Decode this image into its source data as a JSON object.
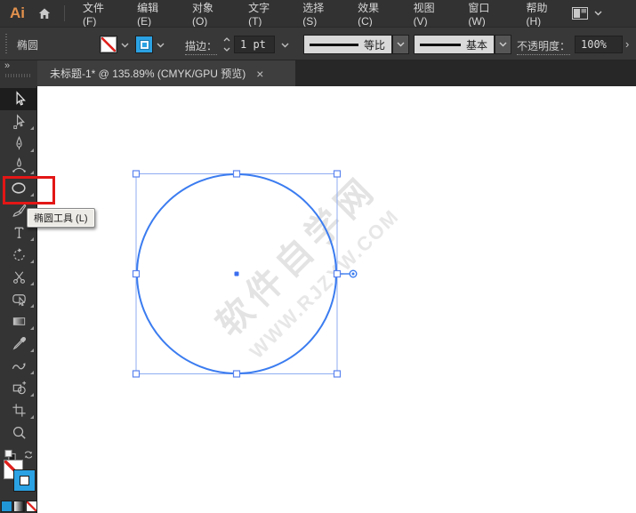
{
  "colors": {
    "shape_stroke_blue": "#3b7cf0",
    "selection_box_blue": "#8fadf2",
    "handle_border_blue": "#5b84ee",
    "stroke_swatch_blue": "#2ba2e3",
    "annotation_red": "#e31616",
    "logo_orange": "#e2914d",
    "canvas_white": "#ffffff"
  },
  "menu_bar": {
    "logo": "Ai",
    "items": [
      {
        "label": "文件(F)"
      },
      {
        "label": "编辑(E)"
      },
      {
        "label": "对象(O)"
      },
      {
        "label": "文字(T)"
      },
      {
        "label": "选择(S)"
      },
      {
        "label": "效果(C)"
      },
      {
        "label": "视图(V)"
      },
      {
        "label": "窗口(W)"
      },
      {
        "label": "帮助(H)"
      }
    ]
  },
  "control_bar": {
    "context_label": "椭圆",
    "stroke_label": "描边：",
    "stroke_weight_value": "1 pt",
    "width_profile_value": "等比",
    "brush_value": "基本",
    "opacity_label": "不透明度：",
    "opacity_value": "100%",
    "more_glyph": "›"
  },
  "tab_bar": {
    "document_title": "未标题-1* @ 135.89% (CMYK/GPU 预览)",
    "close_glyph": "×"
  },
  "toolbar": {
    "expand_glyph": "»",
    "type_tool_glyph": "T",
    "tools": [
      {
        "name": "selection-tool",
        "state": "active"
      },
      {
        "name": "direct-selection-tool"
      },
      {
        "name": "pen-tool"
      },
      {
        "name": "curvature-tool"
      },
      {
        "name": "ellipse-tool",
        "state": "highlighted"
      },
      {
        "name": "paintbrush-tool"
      },
      {
        "name": "type-tool"
      },
      {
        "name": "rotate-tool"
      },
      {
        "name": "scissors-tool"
      },
      {
        "name": "shaper-tool"
      },
      {
        "name": "gradient-tool"
      },
      {
        "name": "eyedropper-tool"
      },
      {
        "name": "width-tool"
      },
      {
        "name": "shape-builder-tool"
      },
      {
        "name": "artboard-tool"
      },
      {
        "name": "zoom-tool"
      }
    ]
  },
  "canvas": {
    "tooltip_text": "椭圆工具 (L)",
    "watermark_line1": "软件自学网",
    "watermark_line2": "WWW.RJZXW.COM",
    "shape": {
      "type": "ellipse",
      "stroke_pt": "1 pt",
      "selected": true
    }
  }
}
